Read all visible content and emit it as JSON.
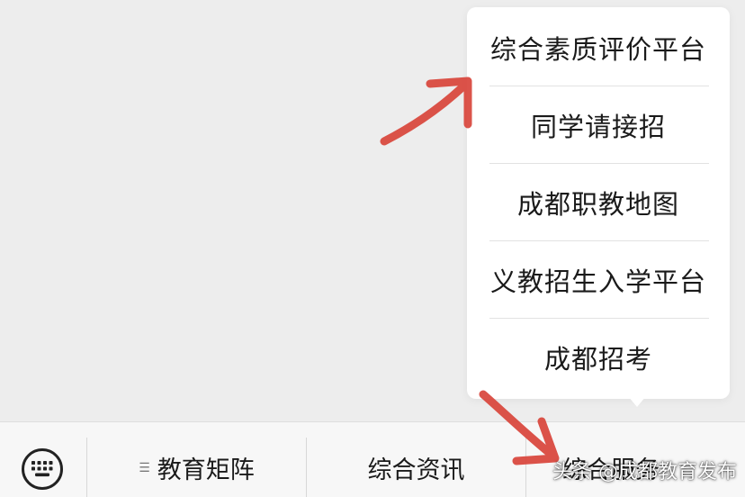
{
  "popup_menu": {
    "items": [
      {
        "label": "综合素质评价平台"
      },
      {
        "label": "同学请接招"
      },
      {
        "label": "成都职教地图"
      },
      {
        "label": "义教招生入学平台"
      },
      {
        "label": "成都招考"
      }
    ]
  },
  "bottom_menu": {
    "tabs": [
      {
        "label": "教育矩阵",
        "has_submenu_glyph": true
      },
      {
        "label": "综合资讯"
      },
      {
        "label": "综合服务"
      }
    ]
  },
  "watermark": "头条 @成都教育发布",
  "colors": {
    "annotation_arrow": "#d9453b",
    "background": "#ededed",
    "popup_bg": "#ffffff"
  },
  "icons": {
    "keyboard": "keyboard-icon",
    "submenu": "menu-lines-icon"
  }
}
